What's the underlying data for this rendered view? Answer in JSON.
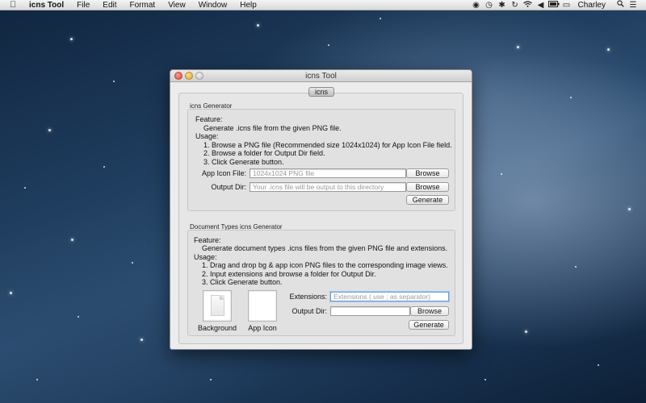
{
  "menubar": {
    "apple_icon": "apple-icon",
    "app_name": "icns Tool",
    "menus": [
      "File",
      "Edit",
      "Format",
      "View",
      "Window",
      "Help"
    ],
    "user": "Charley"
  },
  "window": {
    "title": "icns Tool",
    "tab_label": "icns",
    "icns_generator": {
      "title": "icns Generator",
      "feature_heading": "Feature:",
      "feature_text": "Generate .icns file from the given PNG file.",
      "usage_heading": "Usage:",
      "steps": [
        "1. Browse a PNG file (Recommended size 1024x1024) for App Icon File field.",
        "2. Browse a folder for Output Dir field.",
        "3. Click Generate button."
      ],
      "app_icon_label": "App Icon File:",
      "app_icon_placeholder": "1024x1024 PNG file",
      "output_dir_label": "Output Dir:",
      "output_dir_placeholder": "Your .icns file will be output to this directory",
      "browse_label": "Browse",
      "generate_label": "Generate"
    },
    "doc_types_generator": {
      "title": "Document Types icns Generator",
      "feature_heading": "Feature:",
      "feature_text": "Generate document types .icns files from the given PNG file and extensions.",
      "usage_heading": "Usage:",
      "steps": [
        "1. Drag and drop bg & app icon PNG files to the corresponding image views.",
        "2. Input extensions and browse a folder for Output Dir.",
        "3. Click Generate button."
      ],
      "background_caption": "Background",
      "app_icon_caption": "App Icon",
      "extensions_label": "Extensions:",
      "extensions_placeholder": "Extensions ( use ; as separator)",
      "output_dir_label": "Output Dir:",
      "output_dir_value": "",
      "browse_label": "Browse",
      "generate_label": "Generate"
    }
  }
}
